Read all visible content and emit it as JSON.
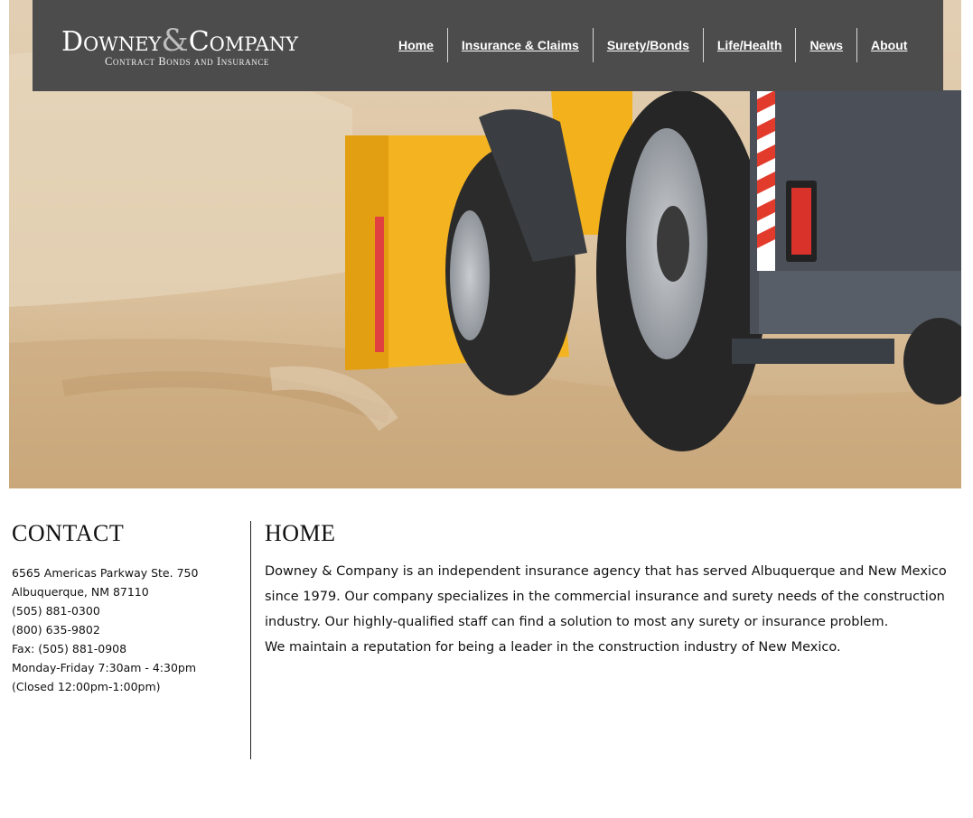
{
  "logo": {
    "name_part1": "Downey",
    "ampersand": "&",
    "name_part2": "Company",
    "tagline": "Contract Bonds and Insurance"
  },
  "nav": {
    "items": [
      {
        "label": "Home"
      },
      {
        "label": "Insurance & Claims"
      },
      {
        "label": "Surety/Bonds"
      },
      {
        "label": "Life/Health"
      },
      {
        "label": "News"
      },
      {
        "label": "About"
      }
    ]
  },
  "hero": {
    "description_icon": "construction-loader-image"
  },
  "contact": {
    "heading": "CONTACT",
    "lines": [
      "6565 Americas Parkway Ste. 750",
      "Albuquerque, NM 87110",
      "(505) 881-0300",
      "(800) 635-9802",
      "Fax: (505) 881-0908",
      "Monday-Friday 7:30am - 4:30pm",
      "(Closed 12:00pm-1:00pm)"
    ]
  },
  "main": {
    "heading": "HOME",
    "paragraph": "Downey & Company is an independent insurance agency that has served Albuquerque and New Mexico since 1979. Our company specializes in the commercial insurance and surety needs of the construction industry. Our highly-qualified staff can find a solution to most any surety or insurance problem.",
    "paragraph2": "We maintain a reputation for being a leader in the construction industry of New Mexico."
  },
  "colors": {
    "header_bg": "#4c4c4c",
    "machine_yellow": "#f3b21c",
    "sand": "#d9c6a9"
  }
}
